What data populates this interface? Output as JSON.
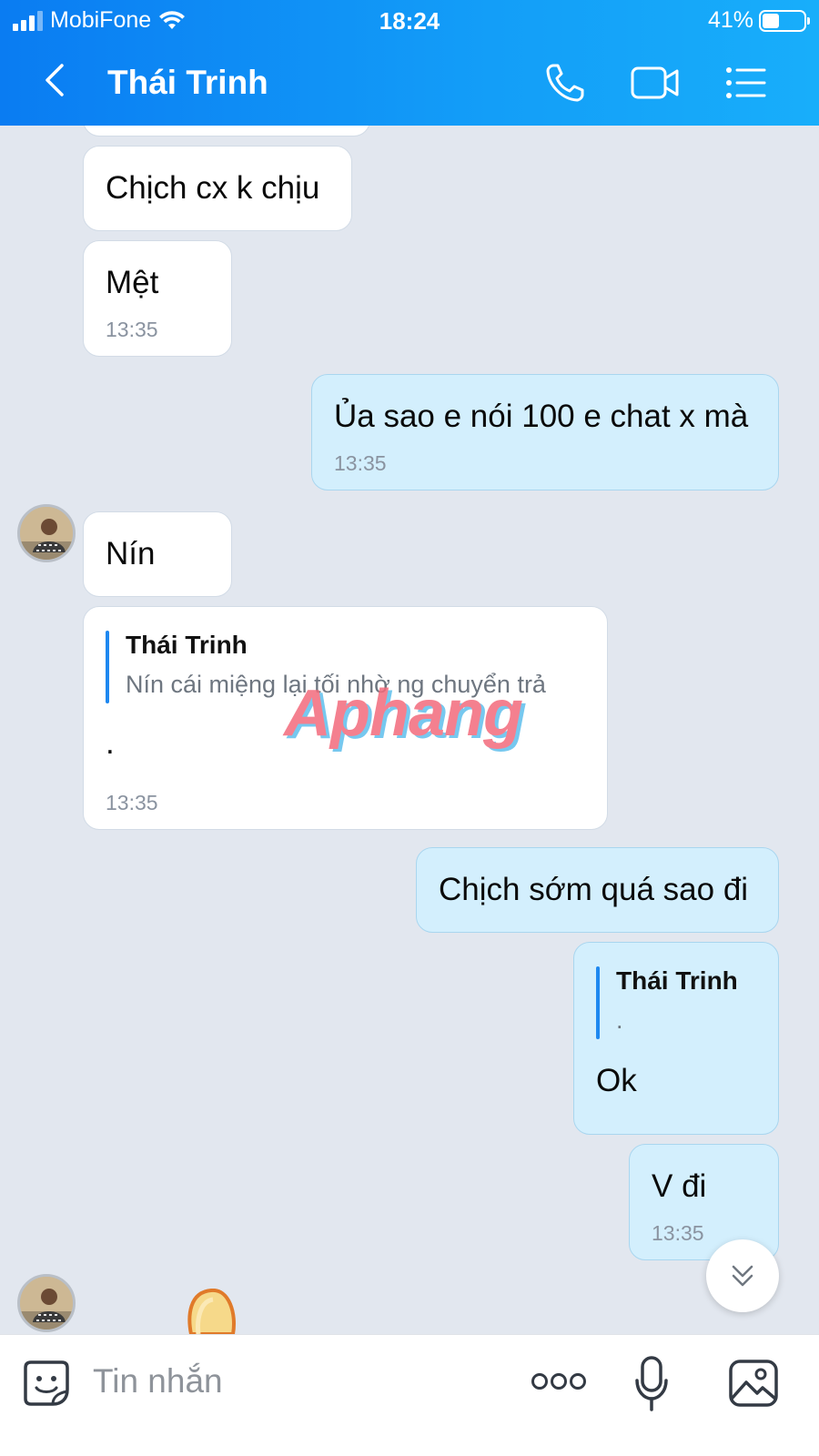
{
  "status_bar": {
    "carrier": "MobiFone",
    "time": "18:24",
    "battery": "41%",
    "battery_level": 0.41
  },
  "header": {
    "title": "Thái Trinh",
    "back_icon": "chevron-left-icon",
    "call_icon": "phone-icon",
    "video_icon": "video-camera-icon",
    "menu_icon": "list-menu-icon"
  },
  "messages": [
    {
      "dir": "in",
      "text": "Chịch cx k chịu"
    },
    {
      "dir": "in",
      "text": "Mệt",
      "time": "13:35"
    },
    {
      "dir": "out",
      "text": "Ủa sao e nói 100 e chat x mà",
      "time": "13:35"
    },
    {
      "dir": "in",
      "text": "Nín"
    },
    {
      "dir": "in",
      "quote": {
        "name": "Thái Trinh",
        "text": "Nín cái miệng lại tối nhờ ng chuyển trả"
      },
      "text": ".",
      "time": "13:35"
    },
    {
      "dir": "out",
      "text": "Chịch sớm quá sao đi"
    },
    {
      "dir": "out",
      "quote": {
        "name": "Thái Trinh",
        "text": "."
      },
      "text": "Ok"
    },
    {
      "dir": "out",
      "text": "V đi",
      "time": "13:35"
    }
  ],
  "watermark": "Aphang",
  "input": {
    "placeholder": "Tin nhắn",
    "sticker_icon": "sticker-icon",
    "more_icon": "more-dots-icon",
    "mic_icon": "microphone-icon",
    "image_icon": "image-icon"
  },
  "scroll_button_icon": "double-chevron-down-icon"
}
